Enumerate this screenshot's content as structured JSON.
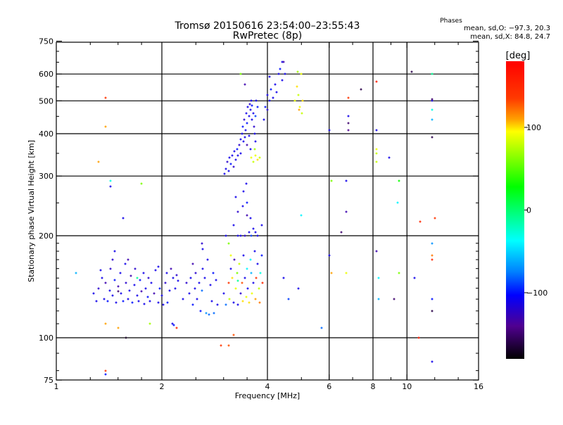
{
  "chart_data": {
    "type": "scatter",
    "title": "Tromsø 20150616 23:54:00–23:55:43",
    "subtitle": "RwPretec (8p)",
    "stats": {
      "heading": "Phases",
      "o_line": "mean, sd,O: −97.3, 20.3",
      "x_line": "mean, sd,X:  84.8, 24.7"
    },
    "xlabel": "Frequency [MHz]",
    "ylabel": "Stationary phase Virtual Height [km]",
    "xscale": "log",
    "yscale": "log",
    "xlim": [
      1,
      16
    ],
    "ylim": [
      75,
      750
    ],
    "xticks": [
      1,
      2,
      4,
      6,
      8,
      10,
      16
    ],
    "yticks": [
      75,
      100,
      200,
      300,
      400,
      500,
      600,
      750
    ],
    "xgrid": [
      2,
      4,
      6,
      8,
      10
    ],
    "ygrid": [
      100,
      200,
      300,
      400,
      500,
      600
    ],
    "colorbar": {
      "label": "[deg]",
      "range": [
        -180,
        180
      ],
      "ticks": [
        100,
        0,
        -100
      ]
    },
    "point_fields": [
      "frequency_MHz",
      "height_km",
      "phase_deg"
    ],
    "points": [
      [
        1.28,
        135,
        -110
      ],
      [
        1.3,
        128,
        -110
      ],
      [
        1.32,
        140,
        -120
      ],
      [
        1.35,
        150,
        -110
      ],
      [
        1.37,
        130,
        -110
      ],
      [
        1.38,
        145,
        -130
      ],
      [
        1.4,
        128,
        -100
      ],
      [
        1.42,
        138,
        -110
      ],
      [
        1.43,
        160,
        -120
      ],
      [
        1.45,
        133,
        -110
      ],
      [
        1.47,
        148,
        -100
      ],
      [
        1.48,
        127,
        -110
      ],
      [
        1.5,
        142,
        -130
      ],
      [
        1.52,
        155,
        -110
      ],
      [
        1.53,
        135,
        -110
      ],
      [
        1.55,
        128,
        -100
      ],
      [
        1.57,
        165,
        -110
      ],
      [
        1.58,
        145,
        -120
      ],
      [
        1.6,
        130,
        -110
      ],
      [
        1.62,
        138,
        -110
      ],
      [
        1.63,
        152,
        -130
      ],
      [
        1.65,
        127,
        -100
      ],
      [
        1.67,
        143,
        -110
      ],
      [
        1.68,
        160,
        -120
      ],
      [
        1.7,
        133,
        -110
      ],
      [
        1.72,
        128,
        -110
      ],
      [
        1.73,
        148,
        -100
      ],
      [
        1.75,
        137,
        -130
      ],
      [
        1.77,
        155,
        -110
      ],
      [
        1.78,
        126,
        -110
      ],
      [
        1.8,
        140,
        -110
      ],
      [
        1.82,
        132,
        -100
      ],
      [
        1.83,
        150,
        -120
      ],
      [
        1.85,
        128,
        -110
      ],
      [
        1.87,
        145,
        -110
      ],
      [
        1.9,
        135,
        -130
      ],
      [
        1.92,
        158,
        -110
      ],
      [
        1.95,
        127,
        -110
      ],
      [
        1.97,
        140,
        -100
      ],
      [
        2.0,
        133,
        -110
      ],
      [
        2.02,
        125,
        -110
      ],
      [
        2.05,
        145,
        -120
      ],
      [
        2.07,
        155,
        -110
      ],
      [
        2.08,
        127,
        -100
      ],
      [
        2.1,
        138,
        -110
      ],
      [
        2.12,
        160,
        -130
      ],
      [
        2.15,
        150,
        -110
      ],
      [
        1.34,
        158,
        -110
      ],
      [
        1.45,
        170,
        -120
      ],
      [
        1.6,
        170,
        -130
      ],
      [
        1.5,
        137,
        -150
      ],
      [
        1.7,
        150,
        -10
      ],
      [
        1.95,
        162,
        -110
      ],
      [
        2.18,
        140,
        -110
      ],
      [
        2.2,
        153,
        -120
      ],
      [
        2.22,
        147,
        -110
      ],
      [
        2.3,
        130,
        -110
      ],
      [
        2.35,
        145,
        -120
      ],
      [
        2.4,
        135,
        -110
      ],
      [
        2.42,
        150,
        -110
      ],
      [
        2.45,
        125,
        -100
      ],
      [
        2.48,
        140,
        -110
      ],
      [
        2.5,
        155,
        -120
      ],
      [
        2.52,
        130,
        -110
      ],
      [
        2.55,
        145,
        -110
      ],
      [
        2.58,
        120,
        -100
      ],
      [
        2.6,
        138,
        -80
      ],
      [
        2.62,
        160,
        -110
      ],
      [
        2.65,
        150,
        -110
      ],
      [
        2.68,
        118,
        -70
      ],
      [
        2.7,
        170,
        -110
      ],
      [
        2.72,
        117,
        -80
      ],
      [
        2.75,
        143,
        -110
      ],
      [
        2.78,
        128,
        -110
      ],
      [
        2.8,
        155,
        -100
      ],
      [
        2.82,
        118,
        -80
      ],
      [
        2.85,
        148,
        -110
      ],
      [
        2.88,
        125,
        -110
      ],
      [
        2.6,
        190,
        -120
      ],
      [
        2.62,
        183,
        -110
      ],
      [
        2.14,
        110,
        -110
      ],
      [
        2.16,
        109,
        -100
      ],
      [
        2.45,
        165,
        -130
      ],
      [
        3.0,
        135,
        -110
      ],
      [
        3.05,
        125,
        -80
      ],
      [
        3.1,
        145,
        140
      ],
      [
        3.12,
        130,
        80
      ],
      [
        3.15,
        160,
        -110
      ],
      [
        3.18,
        150,
        100
      ],
      [
        3.2,
        127,
        -110
      ],
      [
        3.22,
        170,
        -130
      ],
      [
        3.25,
        140,
        90
      ],
      [
        3.28,
        155,
        60
      ],
      [
        3.3,
        125,
        -110
      ],
      [
        3.32,
        165,
        80
      ],
      [
        3.35,
        135,
        -120
      ],
      [
        3.38,
        145,
        130
      ],
      [
        3.4,
        128,
        100
      ],
      [
        3.42,
        175,
        -110
      ],
      [
        3.45,
        150,
        -110
      ],
      [
        3.48,
        132,
        90
      ],
      [
        3.5,
        160,
        -40
      ],
      [
        3.52,
        140,
        -110
      ],
      [
        3.55,
        127,
        100
      ],
      [
        3.58,
        170,
        -40
      ],
      [
        3.6,
        155,
        -60
      ],
      [
        3.62,
        135,
        90
      ],
      [
        3.65,
        145,
        -110
      ],
      [
        3.68,
        180,
        -110
      ],
      [
        3.7,
        130,
        110
      ],
      [
        3.72,
        150,
        140
      ],
      [
        3.75,
        165,
        -110
      ],
      [
        3.78,
        140,
        80
      ],
      [
        3.8,
        127,
        120
      ],
      [
        3.82,
        155,
        -30
      ],
      [
        3.85,
        175,
        -100
      ],
      [
        3.88,
        145,
        150
      ],
      [
        3.1,
        190,
        60
      ],
      [
        3.05,
        200,
        -110
      ],
      [
        3.3,
        147,
        -10
      ],
      [
        3.15,
        175,
        90
      ],
      [
        3.02,
        305,
        -110
      ],
      [
        3.05,
        315,
        -110
      ],
      [
        3.08,
        330,
        -120
      ],
      [
        3.1,
        310,
        -110
      ],
      [
        3.12,
        340,
        -110
      ],
      [
        3.15,
        325,
        -100
      ],
      [
        3.18,
        345,
        -110
      ],
      [
        3.2,
        320,
        -120
      ],
      [
        3.22,
        355,
        -110
      ],
      [
        3.25,
        335,
        -110
      ],
      [
        3.28,
        360,
        -100
      ],
      [
        3.3,
        345,
        -110
      ],
      [
        3.32,
        370,
        -120
      ],
      [
        3.35,
        385,
        -110
      ],
      [
        3.36,
        350,
        -110
      ],
      [
        3.38,
        400,
        -110
      ],
      [
        3.4,
        420,
        -100
      ],
      [
        3.42,
        380,
        -110
      ],
      [
        3.44,
        440,
        -120
      ],
      [
        3.46,
        410,
        -110
      ],
      [
        3.48,
        460,
        -110
      ],
      [
        3.5,
        430,
        -100
      ],
      [
        3.52,
        480,
        -110
      ],
      [
        3.54,
        450,
        -110
      ],
      [
        3.56,
        490,
        -120
      ],
      [
        3.58,
        470,
        -110
      ],
      [
        3.6,
        500,
        -110
      ],
      [
        3.62,
        485,
        -100
      ],
      [
        3.64,
        460,
        -110
      ],
      [
        3.66,
        420,
        -120
      ],
      [
        3.68,
        400,
        -110
      ],
      [
        3.7,
        380,
        -110
      ],
      [
        3.45,
        390,
        -110
      ],
      [
        3.5,
        370,
        -130
      ],
      [
        3.55,
        395,
        -110
      ],
      [
        3.58,
        360,
        -110
      ],
      [
        3.62,
        440,
        -110
      ],
      [
        3.7,
        450,
        -90
      ],
      [
        3.72,
        500,
        -110
      ],
      [
        3.75,
        480,
        -100
      ],
      [
        3.6,
        340,
        90
      ],
      [
        3.65,
        330,
        80
      ],
      [
        3.7,
        345,
        90
      ],
      [
        3.75,
        335,
        100
      ],
      [
        3.8,
        340,
        80
      ],
      [
        3.68,
        360,
        70
      ],
      [
        3.2,
        215,
        -110
      ],
      [
        3.25,
        260,
        -110
      ],
      [
        3.3,
        235,
        -120
      ],
      [
        3.35,
        200,
        -110
      ],
      [
        3.4,
        245,
        -110
      ],
      [
        3.42,
        270,
        -110
      ],
      [
        3.45,
        200,
        -120
      ],
      [
        3.48,
        285,
        -110
      ],
      [
        3.5,
        250,
        -100
      ],
      [
        3.55,
        205,
        -110
      ],
      [
        3.58,
        225,
        -110
      ],
      [
        3.6,
        200,
        -90
      ],
      [
        3.65,
        210,
        -110
      ],
      [
        3.7,
        205,
        -110
      ],
      [
        3.75,
        200,
        -110
      ],
      [
        3.5,
        230,
        -130
      ],
      [
        3.3,
        200,
        -110
      ],
      [
        3.85,
        215,
        -110
      ],
      [
        3.9,
        440,
        -110
      ],
      [
        3.95,
        480,
        -100
      ],
      [
        4.0,
        520,
        -110
      ],
      [
        4.05,
        500,
        -110
      ],
      [
        4.1,
        540,
        -100
      ],
      [
        4.15,
        510,
        -110
      ],
      [
        4.2,
        560,
        -110
      ],
      [
        4.0,
        470,
        -120
      ],
      [
        4.05,
        590,
        -110
      ],
      [
        4.3,
        600,
        -110
      ],
      [
        4.35,
        620,
        -100
      ],
      [
        4.4,
        650,
        -110
      ],
      [
        4.45,
        650,
        -130
      ],
      [
        4.5,
        600,
        -110
      ],
      [
        4.4,
        575,
        -110
      ],
      [
        4.25,
        530,
        -110
      ],
      [
        4.8,
        500,
        90
      ],
      [
        4.85,
        550,
        100
      ],
      [
        4.9,
        520,
        80
      ],
      [
        4.95,
        480,
        90
      ],
      [
        5.0,
        600,
        90
      ],
      [
        5.02,
        460,
        80
      ],
      [
        4.88,
        610,
        70
      ],
      [
        5.05,
        500,
        100
      ],
      [
        4.92,
        470,
        110
      ],
      [
        1.14,
        155,
        -60
      ],
      [
        1.38,
        510,
        140
      ],
      [
        1.38,
        420,
        110
      ],
      [
        1.32,
        330,
        110
      ],
      [
        1.43,
        290,
        -30
      ],
      [
        1.43,
        280,
        -110
      ],
      [
        1.55,
        225,
        -110
      ],
      [
        1.47,
        180,
        -110
      ],
      [
        1.58,
        100,
        -170
      ],
      [
        1.75,
        285,
        60
      ],
      [
        1.38,
        110,
        110
      ],
      [
        1.5,
        107,
        110
      ],
      [
        1.85,
        110,
        70
      ],
      [
        1.38,
        80,
        140
      ],
      [
        1.38,
        78,
        -100
      ],
      [
        2.2,
        107,
        150
      ],
      [
        2.95,
        95,
        140
      ],
      [
        3.1,
        95,
        130
      ],
      [
        3.2,
        102,
        130
      ],
      [
        3.35,
        600,
        60
      ],
      [
        3.45,
        560,
        -130
      ],
      [
        4.6,
        130,
        -90
      ],
      [
        4.45,
        150,
        -110
      ],
      [
        4.9,
        140,
        -110
      ],
      [
        5.0,
        230,
        -40
      ],
      [
        5.7,
        107,
        -80
      ],
      [
        6.0,
        410,
        -110
      ],
      [
        6.0,
        175,
        -110
      ],
      [
        6.1,
        290,
        60
      ],
      [
        6.1,
        155,
        110
      ],
      [
        6.5,
        205,
        -150
      ],
      [
        6.7,
        290,
        -110
      ],
      [
        6.7,
        235,
        -130
      ],
      [
        6.7,
        155,
        90
      ],
      [
        6.8,
        510,
        140
      ],
      [
        6.8,
        450,
        -110
      ],
      [
        6.8,
        410,
        -140
      ],
      [
        6.8,
        430,
        -150
      ],
      [
        7.4,
        540,
        -160
      ],
      [
        8.2,
        570,
        160
      ],
      [
        8.2,
        410,
        -110
      ],
      [
        8.2,
        180,
        -130
      ],
      [
        8.3,
        150,
        -40
      ],
      [
        8.3,
        130,
        -60
      ],
      [
        8.2,
        350,
        80
      ],
      [
        8.2,
        330,
        80
      ],
      [
        8.2,
        360,
        90
      ],
      [
        8.9,
        340,
        -110
      ],
      [
        9.5,
        290,
        30
      ],
      [
        9.4,
        250,
        -40
      ],
      [
        9.5,
        155,
        60
      ],
      [
        9.2,
        130,
        -150
      ],
      [
        10.3,
        610,
        -160
      ],
      [
        10.5,
        150,
        -110
      ],
      [
        10.8,
        100,
        160
      ],
      [
        10.9,
        220,
        150
      ],
      [
        11.8,
        600,
        -10
      ],
      [
        11.8,
        500,
        -110
      ],
      [
        11.8,
        505,
        -150
      ],
      [
        11.8,
        470,
        -30
      ],
      [
        11.8,
        440,
        -60
      ],
      [
        11.8,
        390,
        -160
      ],
      [
        11.8,
        190,
        -70
      ],
      [
        11.8,
        175,
        120
      ],
      [
        11.8,
        170,
        150
      ],
      [
        11.8,
        130,
        -100
      ],
      [
        11.8,
        85,
        -110
      ],
      [
        12.0,
        225,
        140
      ],
      [
        11.8,
        120,
        -160
      ]
    ]
  }
}
